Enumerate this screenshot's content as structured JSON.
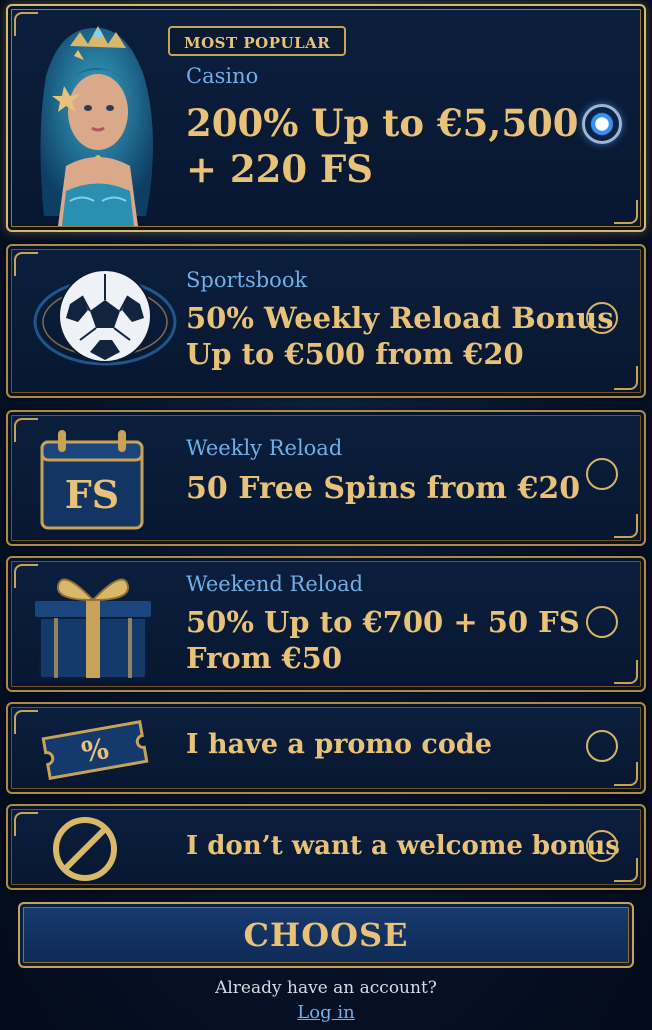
{
  "badge": "MOST POPULAR",
  "options": [
    {
      "category": "Casino",
      "line1": "200% Up to €5,500",
      "line2": "+ 220 FS",
      "selected": true,
      "icon": "mermaid-queen-icon"
    },
    {
      "category": "Sportsbook",
      "line1": "50% Weekly Reload Bonus",
      "line2": "Up to €500 from €20",
      "selected": false,
      "icon": "soccer-ball-icon"
    },
    {
      "category": "Weekly Reload",
      "line1": "50 Free Spins from €20",
      "selected": false,
      "icon": "fs-calendar-icon",
      "icon_text": "FS"
    },
    {
      "category": "Weekend Reload",
      "line1": "50% Up to €700 + 50 FS",
      "line2": "From €50",
      "selected": false,
      "icon": "gift-box-icon"
    },
    {
      "line1": "I have a promo code",
      "selected": false,
      "icon": "ticket-percent-icon",
      "icon_text": "%"
    },
    {
      "line1": "I don’t want a welcome bonus",
      "selected": false,
      "icon": "no-symbol-icon"
    }
  ],
  "choose_label": "CHOOSE",
  "footer": {
    "question": "Already have an account?",
    "login_label": "Log in"
  },
  "colors": {
    "gold": "#e9c27a",
    "blue_text": "#6fb0e6",
    "background": "#061227",
    "radio_active": "#3b8ff0"
  }
}
